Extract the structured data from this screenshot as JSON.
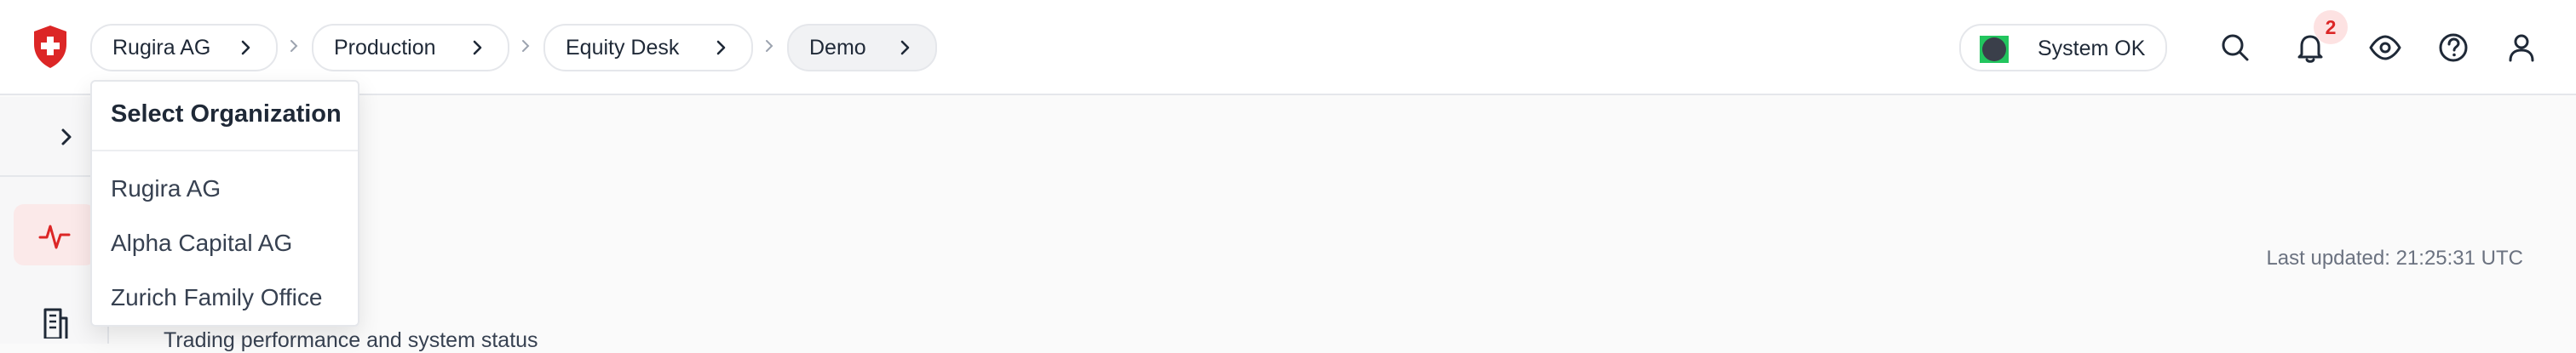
{
  "breadcrumbs": [
    {
      "label": "Rugira AG"
    },
    {
      "label": "Production"
    },
    {
      "label": "Equity Desk"
    },
    {
      "label": "Demo"
    }
  ],
  "status": {
    "label": "System OK",
    "indicator_color": "#22c55e"
  },
  "notifications": {
    "count": "2"
  },
  "toolbar_icons": [
    "search-icon",
    "bell-icon",
    "eye-icon",
    "help-icon",
    "user-icon"
  ],
  "sidebar": {
    "icons": [
      "chevron-right-icon",
      "activity-icon",
      "building-icon"
    ]
  },
  "main": {
    "last_updated": "Last updated: 21:25:31 UTC",
    "subtitle": "Trading performance and system status"
  },
  "org_dropdown": {
    "title": "Select Organization",
    "options": [
      {
        "label": "Rugira AG"
      },
      {
        "label": "Alpha Capital AG"
      },
      {
        "label": "Zurich Family Office"
      }
    ]
  },
  "colors": {
    "accent": "#dc2626",
    "border": "#e5e7eb"
  }
}
